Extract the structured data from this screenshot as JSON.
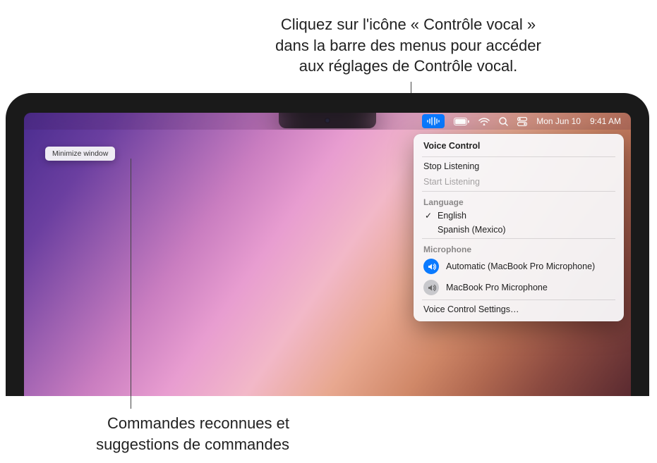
{
  "annotations": {
    "top_l1": "Cliquez sur l'icône « Contrôle vocal »",
    "top_l2": "dans la barre des menus pour accéder",
    "top_l3": "aux réglages de Contrôle vocal.",
    "bottom_l1": "Commandes reconnues et",
    "bottom_l2": "suggestions de commandes"
  },
  "menubar": {
    "date": "Mon Jun 10",
    "time": "9:41 AM"
  },
  "command_bubble": {
    "label": "Minimize window"
  },
  "vc_menu": {
    "title": "Voice Control",
    "stop": "Stop Listening",
    "start": "Start Listening",
    "language_label": "Language",
    "languages": [
      {
        "name": "English",
        "selected": true
      },
      {
        "name": "Spanish (Mexico)",
        "selected": false
      }
    ],
    "microphone_label": "Microphone",
    "microphones": [
      {
        "name": "Automatic (MacBook Pro Microphone)",
        "active": true
      },
      {
        "name": "MacBook Pro Microphone",
        "active": false
      }
    ],
    "settings": "Voice Control Settings…"
  }
}
